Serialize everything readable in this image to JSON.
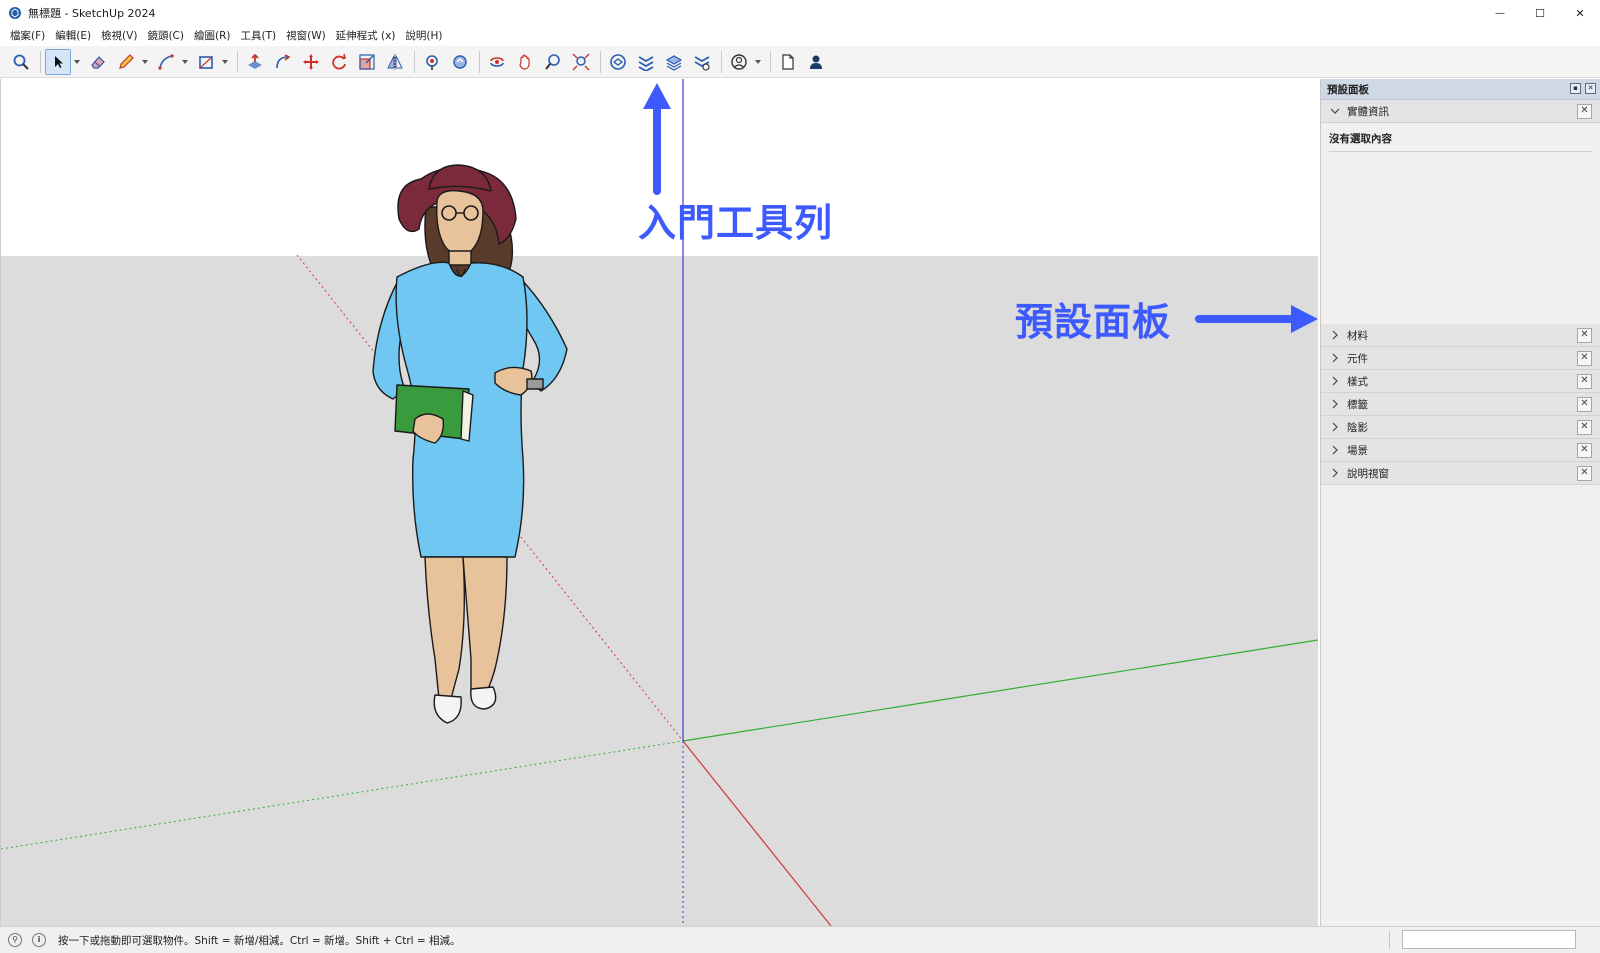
{
  "window": {
    "title": "無標題 - SketchUp 2024",
    "minimize": "—",
    "maximize": "☐",
    "close": "✕"
  },
  "menu": [
    "檔案(F)",
    "編輯(E)",
    "檢視(V)",
    "鏡頭(C)",
    "繪圖(R)",
    "工具(T)",
    "視窗(W)",
    "延伸程式 (x)",
    "說明(H)"
  ],
  "annotations": {
    "toolbar": "入門工具列",
    "tray": "預設面板"
  },
  "tray": {
    "title": "預設面板",
    "entity_info": {
      "label": "實體資訊",
      "content": "沒有選取內容"
    },
    "panels": [
      "材料",
      "元件",
      "樣式",
      "標籤",
      "陰影",
      "場景",
      "說明視窗"
    ],
    "close_glyph": "✕"
  },
  "status": {
    "text": "按一下或拖動即可選取物件。Shift = 新增/相減。Ctrl = 新增。Shift + Ctrl = 相減。",
    "icon_geo": "⚲",
    "icon_info": "i"
  },
  "toolbar_icons": [
    "search-icon",
    "select-icon",
    "eraser-icon",
    "pencil-icon",
    "line-icon",
    "rectangle-icon",
    "push-pull-icon",
    "offset-icon",
    "move-icon",
    "rotate-icon",
    "scale-icon",
    "mirror-icon",
    "paint-bucket-icon",
    "tape-measure-icon",
    "orbit-icon",
    "pan-icon",
    "zoom-icon",
    "zoom-extents-icon",
    "3d-warehouse-icon",
    "extension-warehouse-icon",
    "layout-icon",
    "extension-manager-icon",
    "account-icon",
    "new-file-icon",
    "user-icon"
  ],
  "colors": {
    "axis_red": "#d33a3a",
    "axis_green": "#32b032",
    "axis_blue": "#3a3ad8",
    "annotation": "#3d5afe",
    "ground": "#dcdcdc",
    "sky": "#ffffff",
    "dress": "#6fc7f2",
    "hat": "#7a2a3a",
    "skin": "#e8c29a"
  }
}
